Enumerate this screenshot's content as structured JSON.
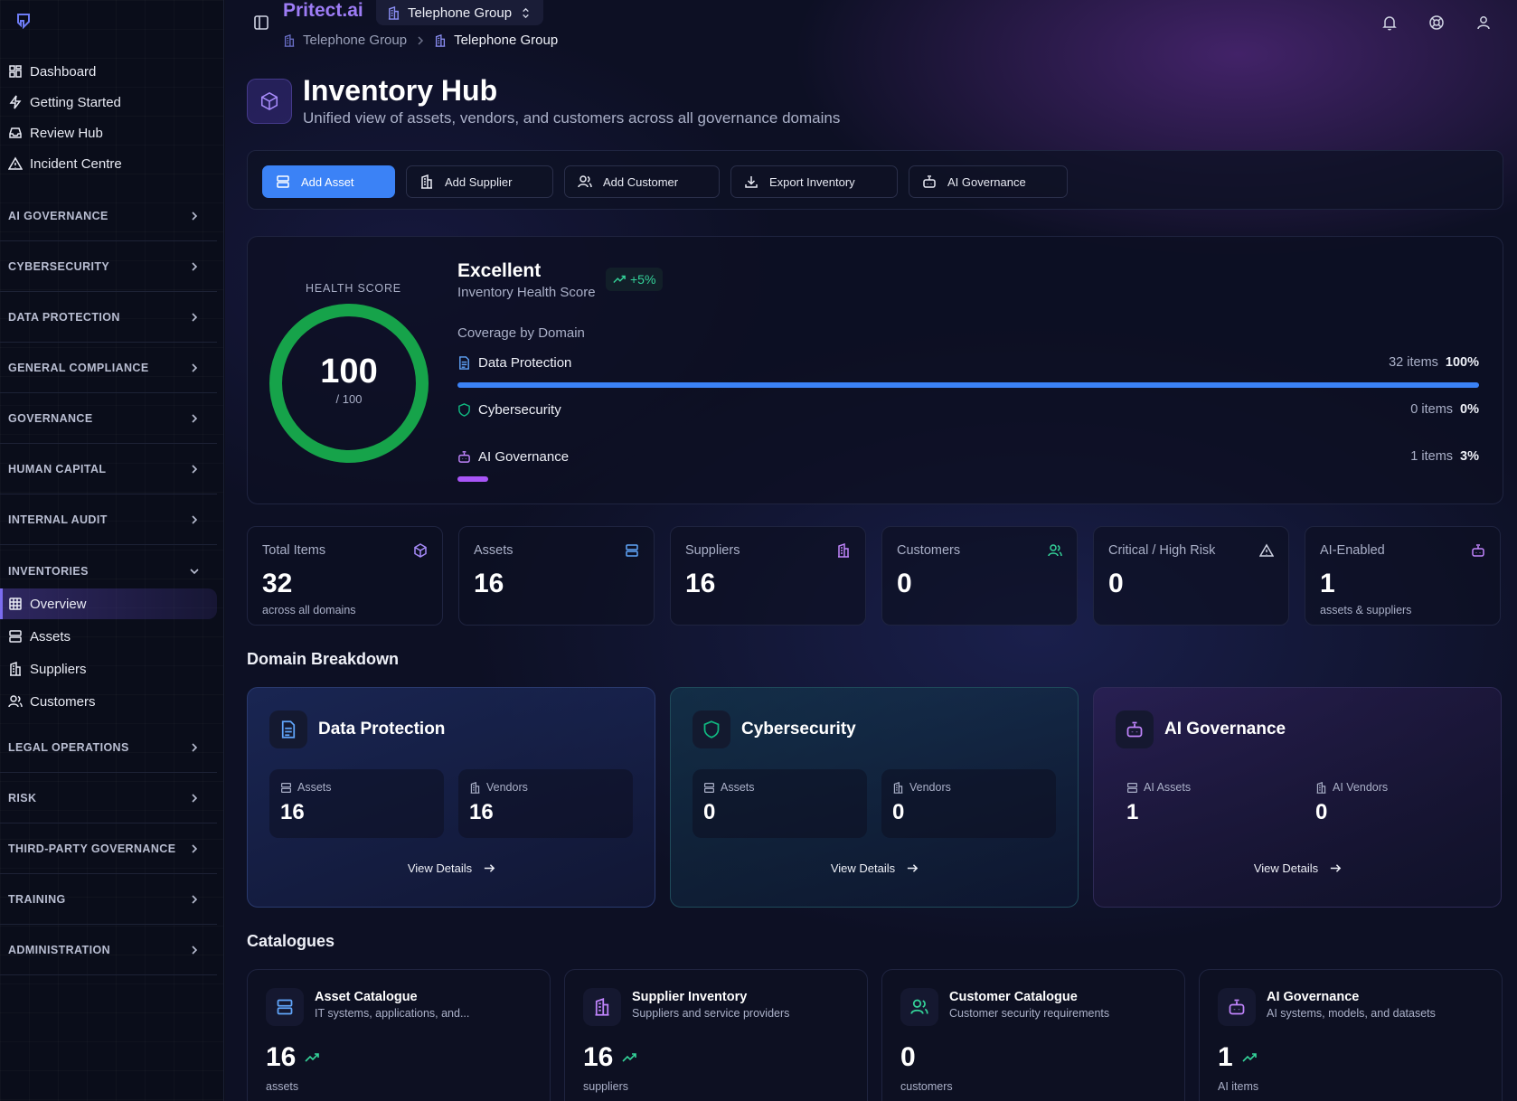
{
  "app": {
    "brand": "Pritect.ai",
    "org": "Telephone Group"
  },
  "breadcrumb": {
    "root": "Telephone Group",
    "current": "Telephone Group"
  },
  "sidebar": {
    "top_items": [
      "Dashboard",
      "Getting Started",
      "Review Hub",
      "Incident Centre"
    ],
    "sections_a": [
      "AI GOVERNANCE",
      "CYBERSECURITY",
      "DATA PROTECTION",
      "GENERAL COMPLIANCE",
      "GOVERNANCE",
      "HUMAN CAPITAL",
      "INTERNAL AUDIT"
    ],
    "inventories": {
      "label": "INVENTORIES",
      "items": [
        "Overview",
        "Assets",
        "Suppliers",
        "Customers"
      ]
    },
    "sections_b": [
      "LEGAL OPERATIONS",
      "RISK",
      "THIRD-PARTY GOVERNANCE",
      "TRAINING",
      "ADMINISTRATION"
    ]
  },
  "page": {
    "title": "Inventory Hub",
    "subtitle": "Unified view of assets, vendors, and customers across all governance domains"
  },
  "actions": [
    "Add Asset",
    "Add Supplier",
    "Add Customer",
    "Export Inventory",
    "AI Governance"
  ],
  "health": {
    "label": "HEALTH SCORE",
    "score": 100,
    "max": "/ 100",
    "status": "Excellent",
    "status_sub": "Inventory Health Score",
    "trend": "+5%",
    "coverage_title": "Coverage by Domain",
    "coverage": [
      {
        "name": "Data Protection",
        "count": "32 items",
        "pct": "100%",
        "fraction": 1.0,
        "color": "#3b82f6"
      },
      {
        "name": "Cybersecurity",
        "count": "0 items",
        "pct": "0%",
        "fraction": 0.0,
        "color": "#10b981"
      },
      {
        "name": "AI Governance",
        "count": "1 items",
        "pct": "3%",
        "fraction": 0.03,
        "color": "#a855f7"
      }
    ]
  },
  "stats": [
    {
      "label": "Total Items",
      "value": "32",
      "sub": "across all domains",
      "icon": "cube-icon",
      "color": "#a78bfa"
    },
    {
      "label": "Assets",
      "value": "16",
      "sub": "",
      "icon": "server-icon",
      "color": "#60a5fa"
    },
    {
      "label": "Suppliers",
      "value": "16",
      "sub": "",
      "icon": "building-icon",
      "color": "#c084fc"
    },
    {
      "label": "Customers",
      "value": "0",
      "sub": "",
      "icon": "users-icon",
      "color": "#34d399"
    },
    {
      "label": "Critical / High Risk",
      "value": "0",
      "sub": "",
      "icon": "warning-icon",
      "color": "#cfd3e2"
    },
    {
      "label": "AI-Enabled",
      "value": "1",
      "sub": "assets & suppliers",
      "icon": "bot-icon",
      "color": "#c084fc"
    }
  ],
  "domain_breakdown": {
    "title": "Domain Breakdown",
    "link_label": "View Details",
    "cards": [
      {
        "name": "Data Protection",
        "a_label": "Assets",
        "a_value": "16",
        "b_label": "Vendors",
        "b_value": "16"
      },
      {
        "name": "Cybersecurity",
        "a_label": "Assets",
        "a_value": "0",
        "b_label": "Vendors",
        "b_value": "0"
      },
      {
        "name": "AI Governance",
        "a_label": "AI Assets",
        "a_value": "1",
        "b_label": "AI Vendors",
        "b_value": "0"
      }
    ]
  },
  "catalogues": {
    "title": "Catalogues",
    "cards": [
      {
        "name": "Asset Catalogue",
        "desc": "IT systems, applications, and...",
        "value": "16",
        "unit": "assets"
      },
      {
        "name": "Supplier Inventory",
        "desc": "Suppliers and service providers",
        "value": "16",
        "unit": "suppliers"
      },
      {
        "name": "Customer Catalogue",
        "desc": "Customer security requirements",
        "value": "0",
        "unit": "customers"
      },
      {
        "name": "AI Governance",
        "desc": "AI systems, models, and datasets",
        "value": "1",
        "unit": "AI items"
      }
    ]
  }
}
